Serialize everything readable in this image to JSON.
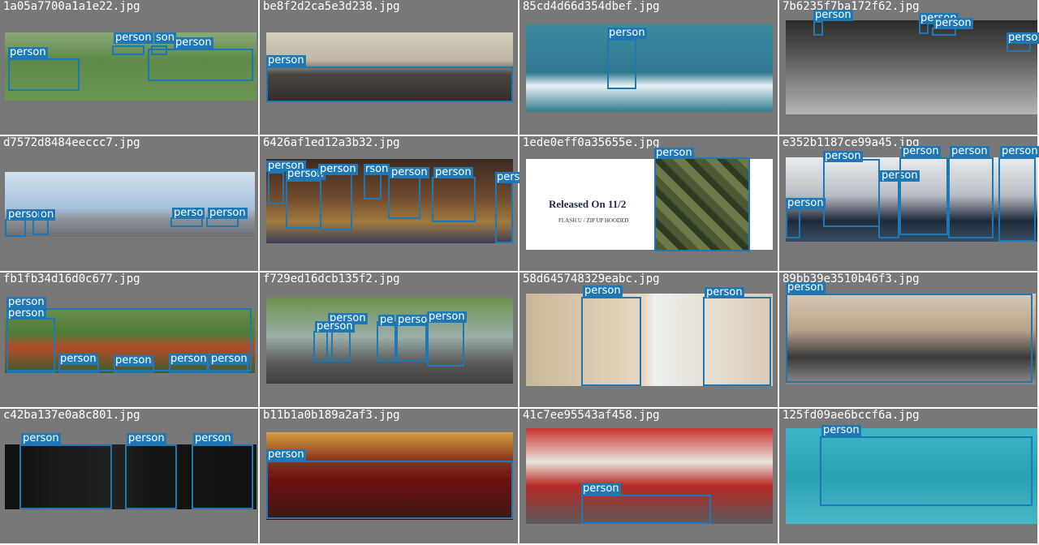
{
  "accent_color": "#1f78b4",
  "background_color": "#787878",
  "tiles": [
    {
      "filename": "1a05a7700a1a1e22.jpg",
      "icon": "photo-icon",
      "labels": [
        "person",
        "person",
        "son",
        "person"
      ]
    },
    {
      "filename": "be8f2d2ca5e3d238.jpg",
      "icon": "photo-icon",
      "labels": [
        "person"
      ]
    },
    {
      "filename": "85cd4d66d354dbef.jpg",
      "icon": "photo-icon",
      "labels": [
        "person"
      ]
    },
    {
      "filename": "7b6235f7ba172f62.jpg",
      "icon": "photo-icon",
      "labels": [
        "person",
        "person",
        "person",
        "perso"
      ]
    },
    {
      "filename": "d7572d8484eeccc7.jpg",
      "icon": "photo-icon",
      "labels": [
        "person",
        "on",
        "perso",
        "person"
      ]
    },
    {
      "filename": "6426af1ed12a3b32.jpg",
      "icon": "photo-icon",
      "labels": [
        "person",
        "person",
        "person",
        "rson",
        "person",
        "person",
        "pers"
      ]
    },
    {
      "filename": "1ede0eff0a35655e.jpg",
      "icon": "photo-icon",
      "labels": [
        "person"
      ],
      "released": "Released On 11/2",
      "product": "FLASH U / ZIP UP HOODED"
    },
    {
      "filename": "e352b1187ce99a45.jpg",
      "icon": "photo-icon",
      "labels": [
        "person",
        "person",
        "person",
        "person",
        "person",
        "person"
      ]
    },
    {
      "filename": "fb1fb34d16d0c677.jpg",
      "icon": "photo-icon",
      "labels": [
        "person",
        "person",
        "person",
        "person",
        "person",
        "person"
      ]
    },
    {
      "filename": "f729ed16dcb135f2.jpg",
      "icon": "photo-icon",
      "labels": [
        "person",
        "person",
        "pe",
        "perso",
        "person"
      ]
    },
    {
      "filename": "58d645748329eabc.jpg",
      "icon": "photo-icon",
      "labels": [
        "person",
        "person"
      ]
    },
    {
      "filename": "89bb39e3510b46f3.jpg",
      "icon": "photo-icon",
      "labels": [
        "person"
      ]
    },
    {
      "filename": "c42ba137e0a8c801.jpg",
      "icon": "photo-icon",
      "labels": [
        "person",
        "person",
        "person"
      ]
    },
    {
      "filename": "b11b1a0b189a2af3.jpg",
      "icon": "photo-icon",
      "labels": [
        "person"
      ]
    },
    {
      "filename": "41c7ee95543af458.jpg",
      "icon": "photo-icon",
      "labels": [
        "person"
      ]
    },
    {
      "filename": "125fd09ae6bccf6a.jpg",
      "icon": "photo-icon",
      "labels": [
        "person"
      ]
    }
  ]
}
